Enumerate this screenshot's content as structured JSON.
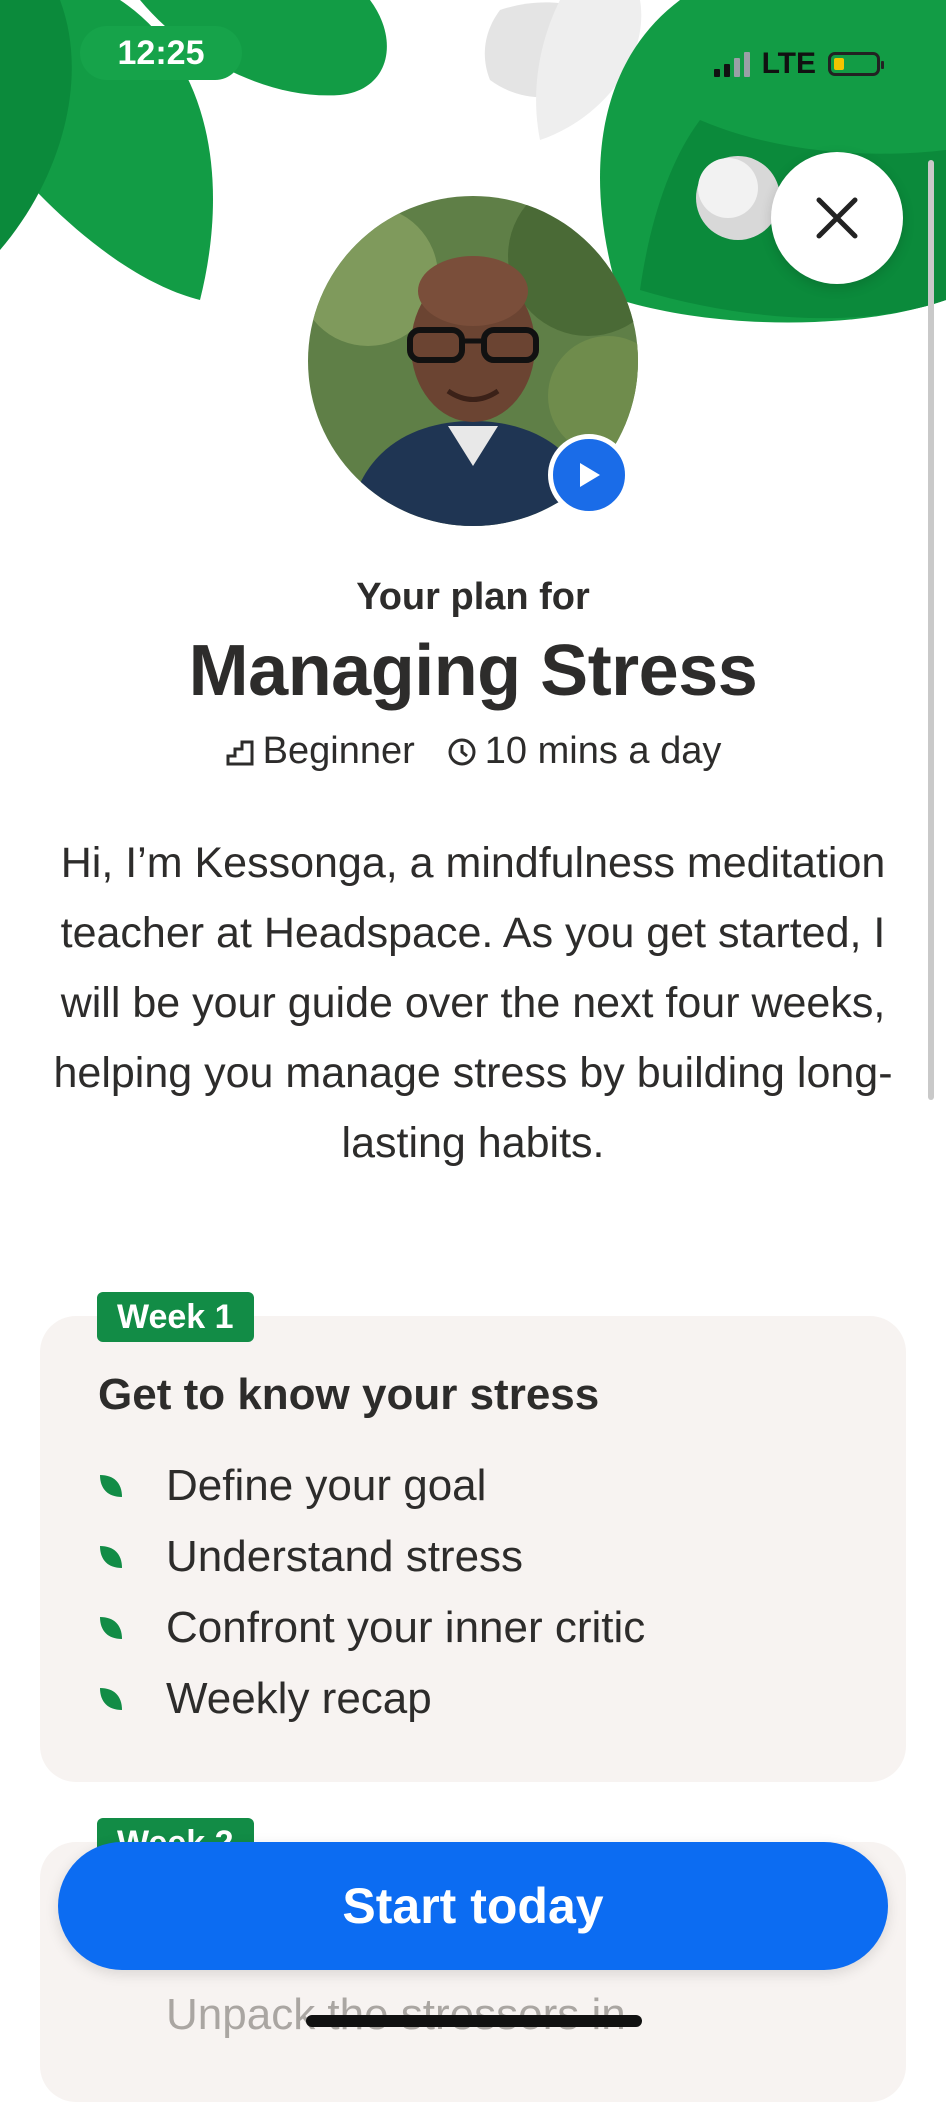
{
  "status_bar": {
    "time": "12:25",
    "network": "LTE"
  },
  "header": {
    "close_icon": "close-x-icon",
    "play_icon": "play-icon"
  },
  "plan": {
    "subtitle": "Your plan for",
    "title": "Managing Stress",
    "level": "Beginner",
    "duration": "10 mins a day",
    "intro": "Hi, I’m Kessonga, a mindfulness meditation teacher at Headspace. As you get started, I will be your guide over the next four weeks, helping you manage stress by building long-lasting habits."
  },
  "weeks": [
    {
      "badge": "Week 1",
      "title": "Get to know your stress",
      "items": [
        "Define your goal",
        "Understand stress",
        "Confront your inner critic",
        "Weekly recap"
      ]
    },
    {
      "badge": "Week 2",
      "preview": "Unpack the stressors in"
    }
  ],
  "cta": {
    "label": "Start today"
  },
  "colors": {
    "accent_green": "#128c46",
    "cta_blue": "#0c6cf2",
    "card_bg": "#f7f3f1"
  }
}
